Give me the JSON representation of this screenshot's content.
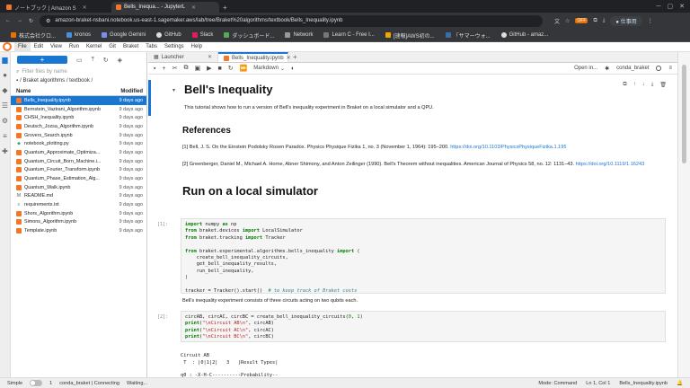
{
  "browser": {
    "tabs": [
      {
        "label": "ノートブック | Amazon S",
        "color": "#f37726",
        "active": false
      },
      {
        "label": "Bells_Inequa... - JupyterL",
        "color": "#f37726",
        "active": true
      }
    ],
    "url": "amazon-braket-nsbani.notebook.us-east-1.sagemaker.aws/lab/tree/Braket%20algorithms/textbook/Bells_Inequality.ipynb",
    "profile_label": "仕事用",
    "badge": "OFF",
    "bookmarks": [
      {
        "label": "株式会社クロ..."
      },
      {
        "label": "kronos"
      },
      {
        "label": "Google Gemini"
      },
      {
        "label": "GitHub"
      },
      {
        "label": "Slack"
      },
      {
        "label": "ダッシュボード..."
      },
      {
        "label": "Network"
      },
      {
        "label": "Learn C - Free I..."
      },
      {
        "label": "[速報]AWS初の..."
      },
      {
        "label": "「サマーウォ..."
      },
      {
        "label": "GitHub - amaz..."
      }
    ]
  },
  "menubar": [
    "File",
    "Edit",
    "View",
    "Run",
    "Kernel",
    "Git",
    "Braket",
    "Tabs",
    "Settings",
    "Help"
  ],
  "filebrowser": {
    "filter_placeholder": "Filter files by name",
    "breadcrumb": "/ Braket algorithms / textbook /",
    "col_name": "Name",
    "col_modified": "Modified",
    "files": [
      {
        "name": "Bells_Inequality.ipynb",
        "modified": "9 days ago",
        "type": "nb",
        "selected": true
      },
      {
        "name": "Bernstein_Vazirani_Algorithm.ipynb",
        "modified": "9 days ago",
        "type": "nb",
        "selected": false
      },
      {
        "name": "CHSH_Inequality.ipynb",
        "modified": "9 days ago",
        "type": "nb",
        "selected": false
      },
      {
        "name": "Deutsch_Jozsa_Algorithm.ipynb",
        "modified": "9 days ago",
        "type": "nb",
        "selected": false
      },
      {
        "name": "Grovers_Search.ipynb",
        "modified": "9 days ago",
        "type": "nb",
        "selected": false
      },
      {
        "name": "notebook_plotting.py",
        "modified": "9 days ago",
        "type": "py",
        "selected": false
      },
      {
        "name": "Quantum_Approximate_Optimiza...",
        "modified": "9 days ago",
        "type": "nb",
        "selected": false
      },
      {
        "name": "Quantum_Circuit_Born_Machine.i...",
        "modified": "9 days ago",
        "type": "nb",
        "selected": false
      },
      {
        "name": "Quantum_Fourier_Transform.ipynb",
        "modified": "9 days ago",
        "type": "nb",
        "selected": false
      },
      {
        "name": "Quantum_Phase_Estimation_Alg...",
        "modified": "9 days ago",
        "type": "nb",
        "selected": false
      },
      {
        "name": "Quantum_Walk.ipynb",
        "modified": "9 days ago",
        "type": "nb",
        "selected": false
      },
      {
        "name": "README.md",
        "modified": "9 days ago",
        "type": "md",
        "selected": false
      },
      {
        "name": "requirements.txt",
        "modified": "9 days ago",
        "type": "txt",
        "selected": false
      },
      {
        "name": "Shors_Algorithm.ipynb",
        "modified": "9 days ago",
        "type": "nb",
        "selected": false
      },
      {
        "name": "Simons_Algorithm.ipynb",
        "modified": "9 days ago",
        "type": "nb",
        "selected": false
      },
      {
        "name": "Template.ipynb",
        "modified": "9 days ago",
        "type": "nb",
        "selected": false
      }
    ]
  },
  "doctabs": [
    {
      "label": "Launcher",
      "active": false
    },
    {
      "label": "Bells_Inequality.ipynb",
      "active": true
    }
  ],
  "nbtoolbar": {
    "cell_type": "Markdown",
    "open_in": "Open in...",
    "kernel": "conda_braket"
  },
  "notebook": {
    "title": "Bell's Inequality",
    "intro": "This tutorial shows how to run a version of Bell's inequality experiment in Braket on a local simulator and a QPU.",
    "references_heading": "References",
    "ref1_text": "[1] Bell, J. S. On the Einstein Podolsky Rosen Paradox. Physics Physique Fizika 1, no. 3 (November 1, 1964): 195–200.",
    "ref1_link": "https://doi.org/10.1103/PhysicsPhysiqueFizika.1.195",
    "ref2_text": "[2] Greenberger, Daniel M., Michael A. Horne, Abner Shimony, and Anton Zeilinger (1990). Bell's Theorem without inequalities. American Journal of Physics 58, no. 12: 1131–43.",
    "ref2_link": "https://doi.org/10.1119/1.16243",
    "local_heading": "Run on a local simulator",
    "prompt1": "[1]:",
    "prompt2": "[2]:",
    "bell_text": "Bell's inequality experiment consists of three circuits acting on two qubits each."
  },
  "statusbar": {
    "simple": "Simple",
    "counts": "1",
    "kernel_status": "conda_braket | Connecting",
    "waiting": "Waiting...",
    "mode": "Mode: Command",
    "position": "Ln 1, Col 1",
    "filename": "Bells_Inequality.ipynb"
  }
}
